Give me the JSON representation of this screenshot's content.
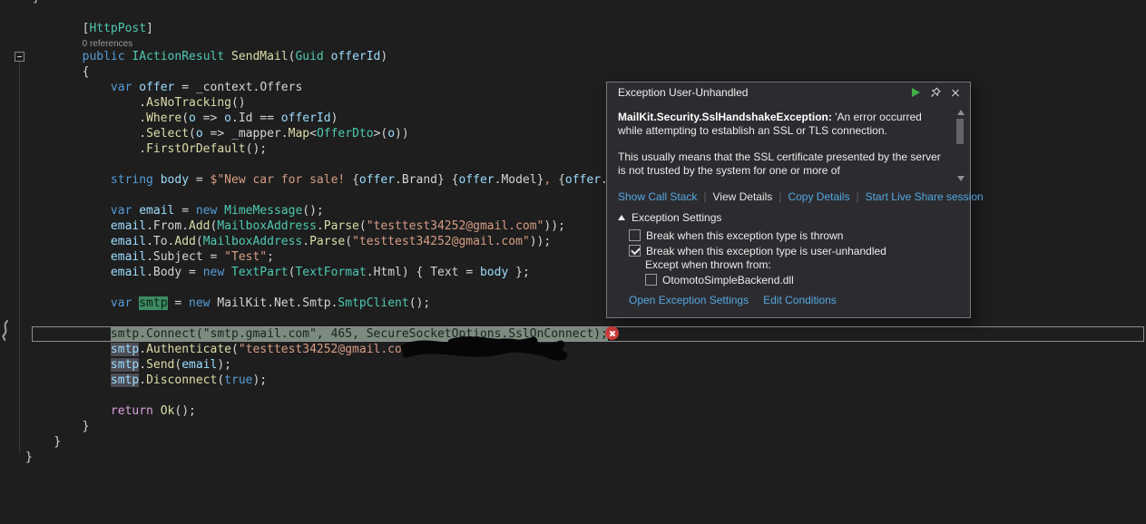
{
  "editor": {
    "lines": [
      {
        "indent": 1,
        "tokens": [
          [
            "}"
          ]
        ]
      },
      {
        "tokens": []
      },
      {
        "indent": 8,
        "tokens": [
          [
            "["
          ],
          [
            "HttpPost",
            "type"
          ],
          [
            "]"
          ]
        ]
      },
      {
        "indent": 8,
        "codelens": true,
        "tokens": [
          [
            "0 references",
            "cl"
          ]
        ]
      },
      {
        "indent": 8,
        "tokens": [
          [
            "public",
            "kw"
          ],
          [
            " "
          ],
          [
            "IActionResult",
            "type"
          ],
          [
            " "
          ],
          [
            "SendMail",
            "m"
          ],
          [
            "("
          ],
          [
            "Guid",
            "type"
          ],
          [
            " "
          ],
          [
            "offerId",
            "v"
          ],
          [
            ")"
          ]
        ]
      },
      {
        "indent": 8,
        "tokens": [
          [
            "{"
          ]
        ]
      },
      {
        "indent": 12,
        "tokens": [
          [
            "var",
            "kw"
          ],
          [
            " "
          ],
          [
            "offer",
            "v"
          ],
          [
            " = "
          ],
          [
            "_context"
          ],
          [
            "."
          ],
          [
            "Offers"
          ]
        ]
      },
      {
        "indent": 16,
        "tokens": [
          [
            "."
          ],
          [
            "AsNoTracking",
            "m"
          ],
          [
            "()"
          ]
        ]
      },
      {
        "indent": 16,
        "tokens": [
          [
            "."
          ],
          [
            "Where",
            "m"
          ],
          [
            "("
          ],
          [
            "o",
            "v"
          ],
          [
            " => "
          ],
          [
            "o",
            "v"
          ],
          [
            "."
          ],
          [
            "Id"
          ],
          [
            " == "
          ],
          [
            "offerId",
            "v"
          ],
          [
            ")"
          ]
        ]
      },
      {
        "indent": 16,
        "tokens": [
          [
            "."
          ],
          [
            "Select",
            "m"
          ],
          [
            "("
          ],
          [
            "o",
            "v"
          ],
          [
            " => "
          ],
          [
            "_mapper"
          ],
          [
            "."
          ],
          [
            "Map",
            "m"
          ],
          [
            "<"
          ],
          [
            "OfferDto",
            "type"
          ],
          [
            ">("
          ],
          [
            "o",
            "v"
          ],
          [
            "))"
          ]
        ]
      },
      {
        "indent": 16,
        "tokens": [
          [
            "."
          ],
          [
            "FirstOrDefault",
            "m"
          ],
          [
            "();"
          ]
        ]
      },
      {
        "tokens": []
      },
      {
        "indent": 12,
        "tokens": [
          [
            "string",
            "kw"
          ],
          [
            " "
          ],
          [
            "body",
            "v"
          ],
          [
            " = "
          ],
          [
            "$\"New car for sale! ",
            "s"
          ],
          [
            "{"
          ],
          [
            "offer",
            "v"
          ],
          [
            "."
          ],
          [
            "Brand"
          ],
          [
            "}"
          ],
          [
            " ",
            "s"
          ],
          [
            "{"
          ],
          [
            "offer",
            "v"
          ],
          [
            "."
          ],
          [
            "Model"
          ],
          [
            "}"
          ],
          [
            ", ",
            "s"
          ],
          [
            "{"
          ],
          [
            "offer",
            "v"
          ],
          [
            "."
          ],
          [
            "B"
          ]
        ]
      },
      {
        "tokens": []
      },
      {
        "indent": 12,
        "tokens": [
          [
            "var",
            "kw"
          ],
          [
            " "
          ],
          [
            "email",
            "v"
          ],
          [
            " = "
          ],
          [
            "new",
            "kw"
          ],
          [
            " "
          ],
          [
            "MimeMessage",
            "type"
          ],
          [
            "();"
          ]
        ]
      },
      {
        "indent": 12,
        "tokens": [
          [
            "email",
            "v"
          ],
          [
            "."
          ],
          [
            "From"
          ],
          [
            "."
          ],
          [
            "Add",
            "m"
          ],
          [
            "("
          ],
          [
            "MailboxAddress",
            "type"
          ],
          [
            "."
          ],
          [
            "Parse",
            "m"
          ],
          [
            "("
          ],
          [
            "\"testtest34252@gmail.com\"",
            "s"
          ],
          [
            "));"
          ]
        ]
      },
      {
        "indent": 12,
        "tokens": [
          [
            "email",
            "v"
          ],
          [
            "."
          ],
          [
            "To"
          ],
          [
            "."
          ],
          [
            "Add",
            "m"
          ],
          [
            "("
          ],
          [
            "MailboxAddress",
            "type"
          ],
          [
            "."
          ],
          [
            "Parse",
            "m"
          ],
          [
            "("
          ],
          [
            "\"testtest34252@gmail.com\"",
            "s"
          ],
          [
            "));"
          ]
        ]
      },
      {
        "indent": 12,
        "tokens": [
          [
            "email",
            "v"
          ],
          [
            "."
          ],
          [
            "Subject"
          ],
          [
            " = "
          ],
          [
            "\"Test\"",
            "s"
          ],
          [
            ";"
          ]
        ]
      },
      {
        "indent": 12,
        "tokens": [
          [
            "email",
            "v"
          ],
          [
            "."
          ],
          [
            "Body"
          ],
          [
            " = "
          ],
          [
            "new",
            "kw"
          ],
          [
            " "
          ],
          [
            "TextPart",
            "type"
          ],
          [
            "("
          ],
          [
            "TextFormat",
            "type"
          ],
          [
            "."
          ],
          [
            "Html"
          ],
          [
            ") { "
          ],
          [
            "Text"
          ],
          [
            " = "
          ],
          [
            "body",
            "v"
          ],
          [
            " };"
          ]
        ]
      },
      {
        "tokens": []
      },
      {
        "indent": 12,
        "tokens": [
          [
            "var",
            "kw"
          ],
          [
            " "
          ],
          [
            "smtp",
            "def"
          ],
          [
            " = "
          ],
          [
            "new",
            "kw"
          ],
          [
            " "
          ],
          [
            "MailKit"
          ],
          [
            "."
          ],
          [
            "Net"
          ],
          [
            "."
          ],
          [
            "Smtp"
          ],
          [
            "."
          ],
          [
            "SmtpClient",
            "type"
          ],
          [
            "();"
          ]
        ]
      },
      {
        "tokens": []
      },
      {
        "indent": 12,
        "exec": true,
        "tokens": [
          [
            "smtp",
            "v"
          ],
          [
            "."
          ],
          [
            "Connect",
            "m"
          ],
          [
            "("
          ],
          [
            "\"smtp.gmail.com\"",
            "s"
          ],
          [
            ", "
          ],
          [
            "465",
            "n"
          ],
          [
            ", "
          ],
          [
            "SecureSocketOptions",
            "type"
          ],
          [
            "."
          ],
          [
            "SslOnConnect"
          ],
          [
            ");"
          ]
        ]
      },
      {
        "indent": 12,
        "tokens": [
          [
            "smtp",
            "ref"
          ],
          [
            "."
          ],
          [
            "Authenticate",
            "m"
          ],
          [
            "("
          ],
          [
            "\"testtest34252@gmail.com\"",
            "s"
          ],
          [
            ", "
          ],
          [
            "                "
          ],
          [
            ");"
          ]
        ]
      },
      {
        "indent": 12,
        "tokens": [
          [
            "smtp",
            "ref"
          ],
          [
            "."
          ],
          [
            "Send",
            "m"
          ],
          [
            "("
          ],
          [
            "email",
            "v"
          ],
          [
            ");"
          ]
        ]
      },
      {
        "indent": 12,
        "tokens": [
          [
            "smtp",
            "ref"
          ],
          [
            "."
          ],
          [
            "Disconnect",
            "m"
          ],
          [
            "("
          ],
          [
            "true",
            "kw"
          ],
          [
            ");"
          ]
        ]
      },
      {
        "tokens": []
      },
      {
        "indent": 12,
        "tokens": [
          [
            "return",
            "ctrl"
          ],
          [
            " "
          ],
          [
            "Ok",
            "m"
          ],
          [
            "();"
          ]
        ]
      },
      {
        "indent": 8,
        "tokens": [
          [
            "}"
          ]
        ]
      },
      {
        "indent": 4,
        "tokens": [
          [
            "}"
          ]
        ]
      },
      {
        "indent": 0,
        "tokens": [
          [
            "}"
          ]
        ]
      }
    ]
  },
  "popup": {
    "title": "Exception User-Unhandled",
    "exception_bold": "MailKit.Security.SslHandshakeException:",
    "exception_text": " 'An error occurred while attempting to establish an SSL or TLS connection.",
    "exception_para2": "This usually means that the SSL certificate presented by the server is not trusted by the system for one or more of",
    "links": [
      "Show Call Stack",
      "View Details",
      "Copy Details",
      "Start Live Share session"
    ],
    "emphasized_link": "View Details",
    "separator": "|",
    "settings": {
      "header": "Exception Settings",
      "checkboxes": [
        {
          "label": "Break when this exception type is thrown",
          "checked": false
        },
        {
          "label": "Break when this exception type is user-unhandled",
          "checked": true
        }
      ],
      "except_label": "Except when thrown from:",
      "module_checkbox": {
        "label": "OtomotoSimpleBackend.dll",
        "checked": false
      },
      "links": [
        "Open Exception Settings",
        "Edit Conditions"
      ]
    }
  },
  "colors": {
    "editor_background": "#1e1e1e",
    "exec_highlight": "#7b8b7f",
    "error_red": "#cf3b3b",
    "link_blue": "#55a7e0",
    "symbol_definition_highlight": "#3d8b63",
    "symbol_reference_highlight": "#4d4d55",
    "continue_green": "#3fae49"
  }
}
